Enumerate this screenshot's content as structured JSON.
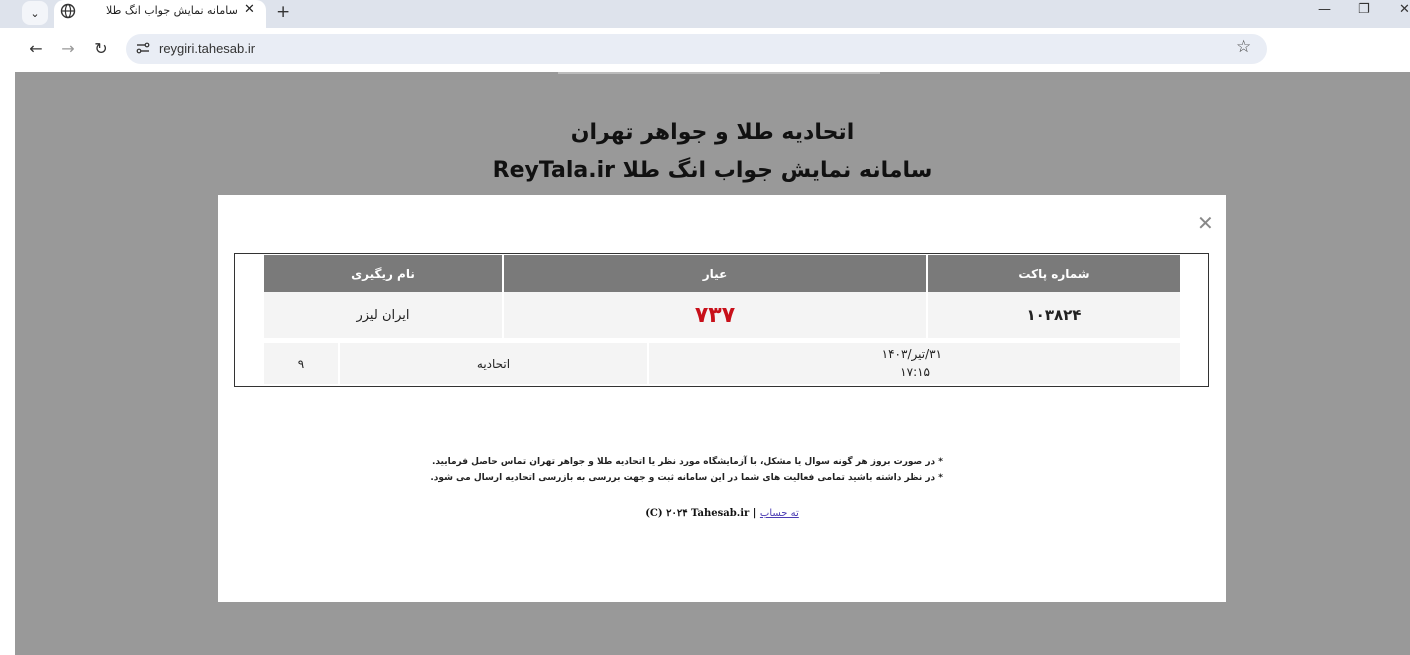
{
  "browser": {
    "tab_title": "سامانه نمایش جواب انگ طلا",
    "url": "reygiri.tahesab.ir",
    "tab_search_icon": "chevron-down-icon",
    "favicon_icon": "globe-icon",
    "window_controls": [
      "minimize-icon",
      "restore-icon",
      "close-icon"
    ]
  },
  "page": {
    "title_line1": "اتحادیه طلا و جواهر تهران",
    "title_line2": "سامانه نمایش جواب انگ طلا ReyTala.ir"
  },
  "table": {
    "headers": {
      "packet": "شماره پاکت",
      "karat": "عیار",
      "assay_name": "نام ریگیری"
    },
    "row": {
      "packet": "۱۰۳۸۲۴",
      "karat": "۷۳۷",
      "assay_name": "ایران لیزر"
    },
    "details": {
      "date": "۳۱/تیر/۱۴۰۳",
      "time": "۱۷:۱۵",
      "union": "اتحادیه",
      "number": "۹"
    }
  },
  "notes": {
    "line1": "* در صورت بروز هر گونه سوال یا مشکل، با آزمایشگاه مورد نظر یا اتحادیه طلا و جواهر تهران تماس حاصل فرمایید.",
    "line2": "* در نظر داشته باشید تمامی فعالیت های شما در این سامانه ثبت و جهت بررسی به بازرسی اتحادیه ارسال می شود."
  },
  "footer": {
    "copyright": "(C) ۲۰۲۴ Tahesab.ir |",
    "link_label": "ته حساب"
  },
  "colors": {
    "karat": "#c8101a",
    "header_bg": "#7a7a7a",
    "overlay": "#999999"
  }
}
